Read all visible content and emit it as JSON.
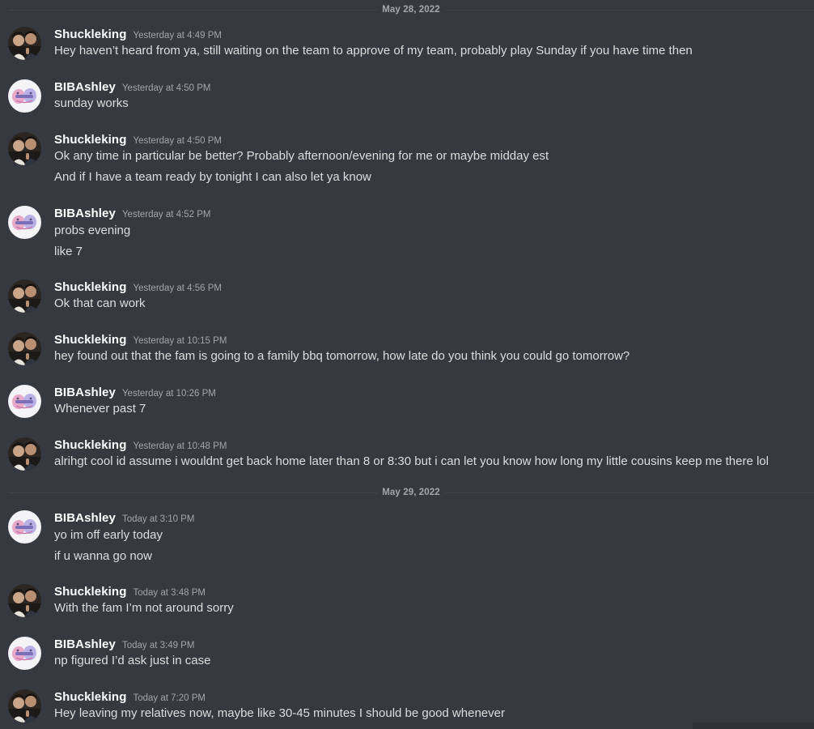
{
  "dividers": [
    {
      "label": "May 28, 2022"
    },
    {
      "label": "May 29, 2022"
    }
  ],
  "users": {
    "shuckleking": {
      "name": "Shuckleking",
      "avatar_icon": "user-photo-avatar-icon"
    },
    "bibashley": {
      "name": "BIBAshley",
      "avatar_icon": "pink-blob-avatar-icon"
    }
  },
  "messages": [
    {
      "author": "Shuckleking",
      "timestamp": "Yesterday at 4:49 PM",
      "lines": [
        "Hey haven’t heard from ya, still waiting on the team to approve of my team, probably play Sunday if you have time then"
      ]
    },
    {
      "author": "BIBAshley",
      "timestamp": "Yesterday at 4:50 PM",
      "lines": [
        "sunday works"
      ]
    },
    {
      "author": "Shuckleking",
      "timestamp": "Yesterday at 4:50 PM",
      "lines": [
        "Ok any time in particular be better? Probably afternoon/evening for me or maybe midday est",
        "And if I have a team ready by tonight I can also let ya know"
      ]
    },
    {
      "author": "BIBAshley",
      "timestamp": "Yesterday at 4:52 PM",
      "lines": [
        "probs evening",
        "like 7"
      ]
    },
    {
      "author": "Shuckleking",
      "timestamp": "Yesterday at 4:56 PM",
      "lines": [
        "Ok that can work"
      ]
    },
    {
      "author": "Shuckleking",
      "timestamp": "Yesterday at 10:15 PM",
      "lines": [
        "hey found out that the fam is going to a family bbq tomorrow, how late do you think you could go tomorrow?"
      ]
    },
    {
      "author": "BIBAshley",
      "timestamp": "Yesterday at 10:26 PM",
      "lines": [
        "Whenever past 7"
      ]
    },
    {
      "author": "Shuckleking",
      "timestamp": "Yesterday at 10:48 PM",
      "lines": [
        "alrihgt cool id assume i wouldnt get back home later than 8 or 8:30 but i can let you know how long my little cousins keep me there lol"
      ]
    },
    {
      "author": "BIBAshley",
      "timestamp": "Today at 3:10 PM",
      "lines": [
        "yo im off early today",
        "if u wanna go now"
      ]
    },
    {
      "author": "Shuckleking",
      "timestamp": "Today at 3:48 PM",
      "lines": [
        "With the fam I’m not around sorry"
      ]
    },
    {
      "author": "BIBAshley",
      "timestamp": "Today at 3:49 PM",
      "lines": [
        "np figured I’d ask just in case"
      ]
    },
    {
      "author": "Shuckleking",
      "timestamp": "Today at 7:20 PM",
      "lines": [
        "Hey leaving my relatives now, maybe like 30-45 minutes I should be good whenever"
      ]
    }
  ],
  "colors": {
    "background": "#36393f",
    "username": "#ffffff",
    "message_text": "#dcddde",
    "timestamp": "#a3a6aa",
    "divider": "#42454a"
  }
}
